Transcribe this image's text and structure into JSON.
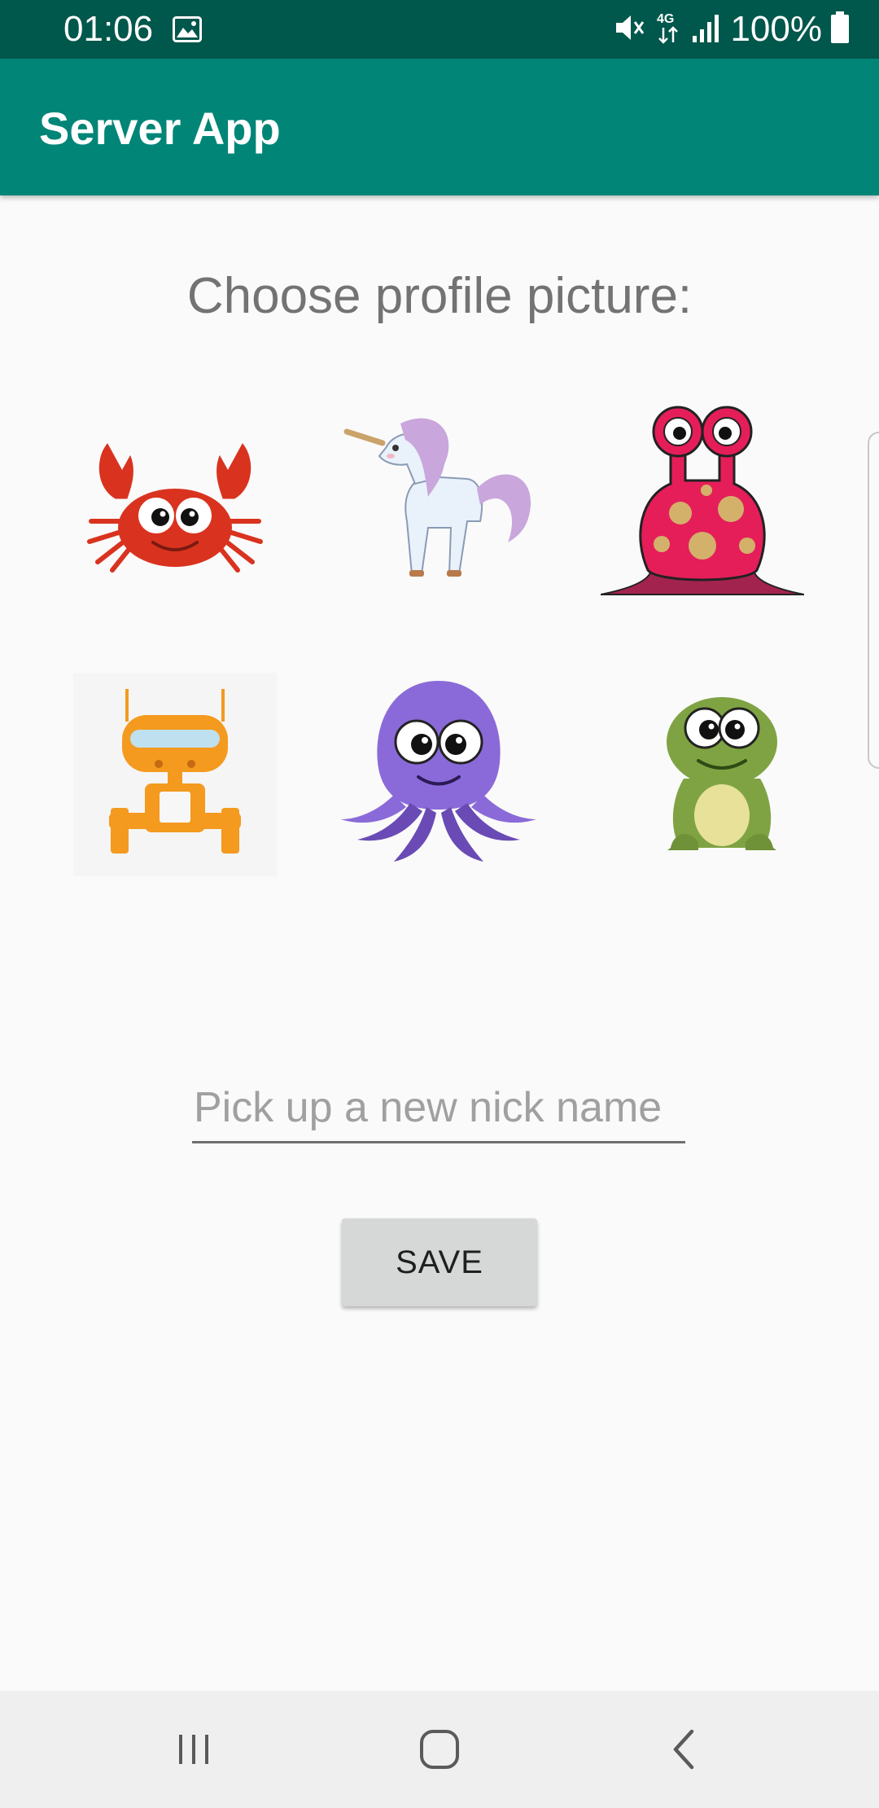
{
  "status_bar": {
    "time": "01:06",
    "battery": "100%",
    "network": "4G",
    "icons": [
      "image-icon",
      "mute-icon",
      "network-4g-icon",
      "signal-icon",
      "battery-icon"
    ]
  },
  "app_bar": {
    "title": "Server App"
  },
  "profile": {
    "prompt": "Choose profile picture:",
    "avatars": [
      {
        "name": "crab",
        "icon": "crab-avatar-icon",
        "color": "#d9331f"
      },
      {
        "name": "unicorn",
        "icon": "unicorn-avatar-icon",
        "color": "#c9a6dc"
      },
      {
        "name": "pink-monster",
        "icon": "monster-avatar-icon",
        "color": "#e51e5a"
      },
      {
        "name": "robot",
        "icon": "robot-avatar-icon",
        "color": "#f39a1f"
      },
      {
        "name": "octopus",
        "icon": "octopus-avatar-icon",
        "color": "#8a6ad8"
      },
      {
        "name": "frog",
        "icon": "frog-avatar-icon",
        "color": "#7fa343"
      }
    ]
  },
  "nickname": {
    "placeholder": "Pick up a new nick name",
    "value": ""
  },
  "save_button": {
    "label": "SAVE"
  },
  "nav_bar": {
    "icons": [
      "recent-apps-icon",
      "home-icon",
      "back-icon"
    ]
  },
  "colors": {
    "status_bar": "#00574b",
    "app_bar": "#008577",
    "background": "#fafafa",
    "button": "#d6d7d7"
  }
}
